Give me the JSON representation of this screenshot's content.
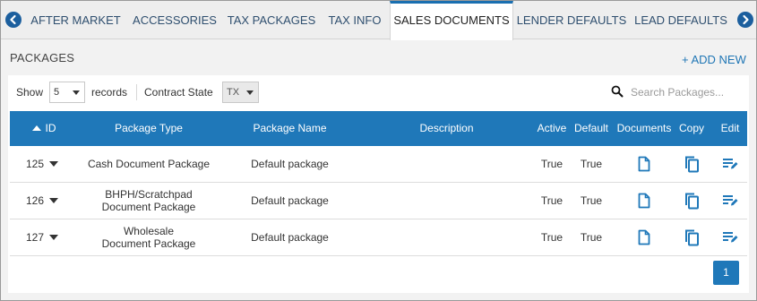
{
  "tabs": [
    {
      "label": "AFTER MARKET",
      "active": false
    },
    {
      "label": "ACCESSORIES",
      "active": false
    },
    {
      "label": "TAX PACKAGES",
      "active": false
    },
    {
      "label": "TAX INFO",
      "active": false
    },
    {
      "label": "SALES DOCUMENTS",
      "active": true
    },
    {
      "label": "LENDER DEFAULTS",
      "active": false
    },
    {
      "label": "LEAD DEFAULTS",
      "active": false
    }
  ],
  "section": {
    "title": "PACKAGES",
    "add_new": "+ ADD NEW"
  },
  "controls": {
    "show_label": "Show",
    "page_size": "5",
    "records_label": "records",
    "contract_state_label": "Contract State",
    "contract_state": "TX",
    "search_placeholder": "Search Packages..."
  },
  "table": {
    "columns": [
      "ID",
      "Package Type",
      "Package Name",
      "Description",
      "Active",
      "Default",
      "Documents",
      "Copy",
      "Edit"
    ],
    "rows": [
      {
        "id": "125",
        "type": "Cash Document Package",
        "name": "Default package",
        "description": "",
        "active": "True",
        "default": "True"
      },
      {
        "id": "126",
        "type": "BHPH/Scratchpad Document Package",
        "name": "Default package",
        "description": "",
        "active": "True",
        "default": "True"
      },
      {
        "id": "127",
        "type": "Wholesale Document Package",
        "name": "Default package",
        "description": "",
        "active": "True",
        "default": "True"
      }
    ]
  },
  "pagination": {
    "current_page": "1"
  },
  "colors": {
    "accent": "#1f78b9",
    "tab_text": "#2f4f6f",
    "nav_arrow": "#1c5f9e"
  }
}
